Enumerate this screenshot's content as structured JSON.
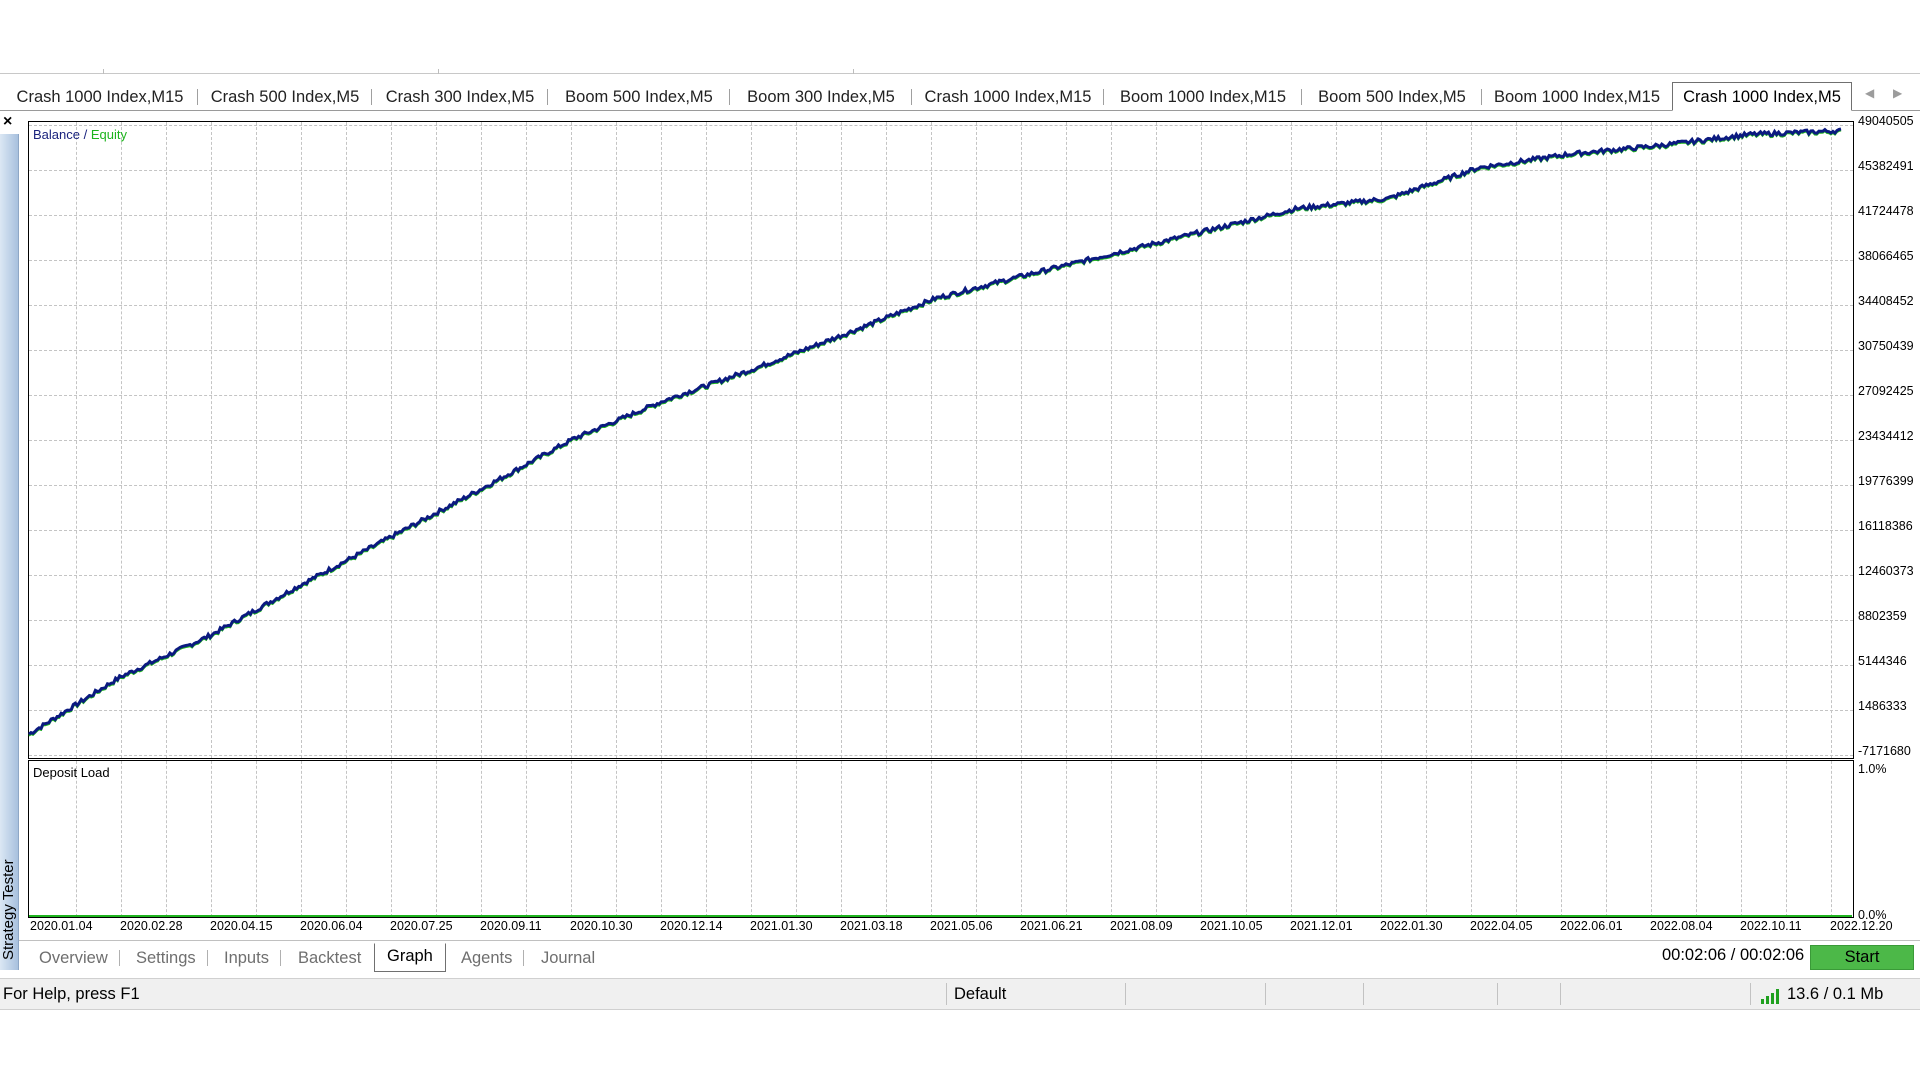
{
  "chart_tabs": [
    "Crash 1000 Index,M15",
    "Crash 500 Index,M5",
    "Crash 300 Index,M5",
    "Boom 500 Index,M5",
    "Boom 300 Index,M5",
    "Crash 1000 Index,M15",
    "Boom 1000 Index,M15",
    "Boom 500 Index,M5",
    "Boom 1000 Index,M15",
    "Crash 1000 Index,M5"
  ],
  "active_chart_tab": 9,
  "tab_scroll": {
    "left_icon": "chevron-left-icon",
    "right_icon": "chevron-right-icon"
  },
  "panel_title": "Strategy Tester",
  "close_label": "×",
  "legend": {
    "balance": "Balance",
    "separator": " / ",
    "equity": "Equity",
    "balance_color": "#1a237e",
    "equity_color": "#1eb41e"
  },
  "deposit_load": {
    "label": "Deposit Load",
    "top_label": "1.0%",
    "bottom_label": "0.0%"
  },
  "chart_data": {
    "type": "line",
    "series": [
      {
        "name": "Balance",
        "color": "#0b1a80"
      },
      {
        "name": "Equity",
        "color": "#1eb41e"
      }
    ],
    "x_ticks": [
      "2020.01.04",
      "2020.02.28",
      "2020.04.15",
      "2020.06.04",
      "2020.07.25",
      "2020.09.11",
      "2020.10.30",
      "2020.12.14",
      "2021.01.30",
      "2021.03.18",
      "2021.05.06",
      "2021.06.21",
      "2021.08.09",
      "2021.10.05",
      "2021.12.01",
      "2022.01.30",
      "2022.04.05",
      "2022.06.01",
      "2022.08.04",
      "2022.10.11",
      "2022.12.20"
    ],
    "y_ticks": [
      "49040505",
      "45382491",
      "41724478",
      "38066465",
      "34408452",
      "30750439",
      "27092425",
      "23434412",
      "19776399",
      "16118386",
      "12460373",
      "8802359",
      "5144346",
      "1486333",
      "-7171680"
    ],
    "ylim": [
      -2171680,
      49040505
    ],
    "x": [
      "2020.01.04",
      "2020.02.28",
      "2020.04.15",
      "2020.06.04",
      "2020.07.25",
      "2020.09.11",
      "2020.10.30",
      "2020.12.14",
      "2021.01.30",
      "2021.03.18",
      "2021.05.06",
      "2021.06.21",
      "2021.08.09",
      "2021.10.05",
      "2021.12.01",
      "2022.01.30",
      "2022.04.05",
      "2022.06.01",
      "2022.08.04",
      "2022.10.11",
      "2022.12.20"
    ],
    "values": [
      -400000,
      4200000,
      7600000,
      11700000,
      15600000,
      19500000,
      23500000,
      26600000,
      29200000,
      32000000,
      34900000,
      36800000,
      38600000,
      40400000,
      42200000,
      43000000,
      45500000,
      46600000,
      47300000,
      48200000,
      48500000
    ],
    "grid": true,
    "legend_position": "top-left"
  },
  "bottom_tabs": [
    "Overview",
    "Settings",
    "Inputs",
    "Backtest",
    "Graph",
    "Agents",
    "Journal"
  ],
  "active_bottom_tab": 4,
  "timer": "00:02:06 / 00:02:06",
  "start_label": "Start",
  "status_bar": {
    "help": "For Help, press F1",
    "profile": "Default",
    "traffic": "13.6 / 0.1 Mb",
    "signal_icon": "signal-bars-icon"
  }
}
